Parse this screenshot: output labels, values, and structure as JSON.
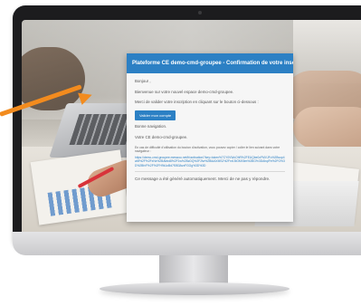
{
  "email": {
    "title": "Plateforme CE demo-cmd-groupee - Confirmation de votre inscription",
    "greeting": "Bonjour ,",
    "welcome": "Bienvenue sur votre nouvel espace demo-cmd-groupee.",
    "instruction": "Merci de valider votre inscription en cliquant sur le bouton ci-dessous :",
    "button_label": "Valider mon compte",
    "closing": "Bonne navigation.",
    "signature": "Votre CE demo-cmd-groupee.",
    "fallback_text": "En cas de difficulté d'utilisation du bouton d'activation, vous pouvez copier / coller le lien suivant dans votre navigateur :",
    "link_text": "https://demo-cmd-groupee.meswoo.net/fr/activation/?key=token%7CY0VWcOhR%2FEUQbe0cFMVJFu%2Bsup4wM%2F%2FxNz%2BAbbd8%2F1w%2BzDQ%2F2fw%2BlAAXMSJ%2Fnr15iGMX6m%2BG%3DAhqIFe%2FG%3D%2BfvF%2F%2FH9k1oBd7f0B3AvzFGGg%3D%3D",
    "footer": "Ce message a été généré automatiquement. Merci de ne pas y répondre."
  },
  "colors": {
    "accent": "#2c80c4",
    "arrow": "#f28b1e"
  }
}
